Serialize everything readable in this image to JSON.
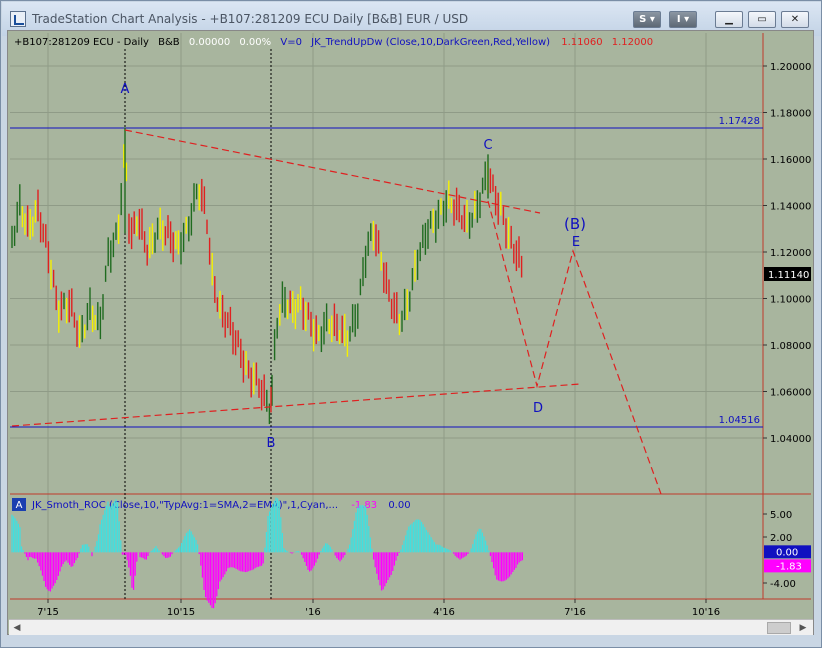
{
  "window": {
    "title": "TradeStation Chart Analysis - +B107:281209 ECU Daily [B&B] EUR / USD",
    "buttons": {
      "s": "S",
      "i": "I"
    }
  },
  "price_pane": {
    "header": {
      "symbol": "+B107:281209 ECU - Daily",
      "data_name": "B&B",
      "change": "0.00000",
      "change_pct": "0.00%",
      "volume": "V=0",
      "indicator": "JK_TrendUpDw (Close,10,DarkGreen,Red,Yellow)",
      "val1": "1.11060",
      "val2": "1.12000"
    },
    "y_ticks": [
      "1.20000",
      "1.18000",
      "1.16000",
      "1.14000",
      "1.12000",
      "1.10000",
      "1.08000",
      "1.06000",
      "1.04000"
    ],
    "current_price": "1.11140",
    "hline_labels": [
      "1.17428",
      "1.04516"
    ],
    "wave_labels": [
      "A",
      "B",
      "C",
      "D",
      "(B)",
      "E"
    ]
  },
  "osc_pane": {
    "badge": "A",
    "title": "JK_Smoth_ROC (Close,10,\"TypAvg:1=SMA,2=EMA)\",1,Cyan,...",
    "val1": "-1.83",
    "val2": "0.00",
    "y_ticks": [
      "5.00",
      "2.00",
      "0.00",
      "-1.83",
      "-4.00"
    ]
  },
  "x_axis": {
    "ticks": [
      "7'15",
      "10'15",
      "'16",
      "4'16",
      "7'16",
      "10'16"
    ]
  },
  "colors": {
    "chart_bg": "#a8b59e",
    "up": "#1f6b1f",
    "down": "#e02020",
    "neutral": "#f5f000",
    "blue": "#1010c0",
    "pink": "#ff00ff",
    "cyan": "#40e0e0"
  }
}
